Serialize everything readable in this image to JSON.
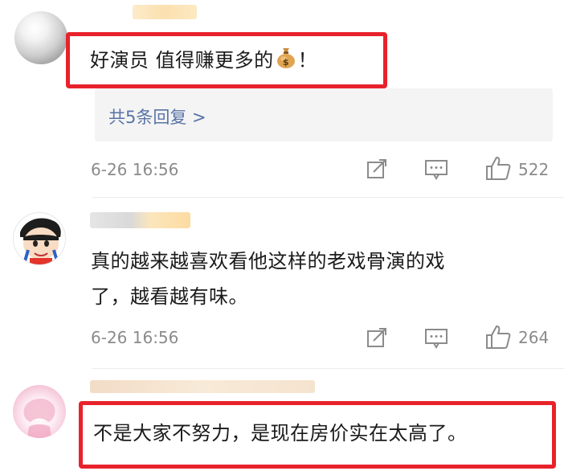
{
  "comments": [
    {
      "text": "好演员 值得赚更多的",
      "emoji_alt": "money-bag",
      "text_suffix": "！",
      "replies_label": "共5条回复 >",
      "time": "6-26 16:56",
      "likes": "522"
    },
    {
      "text_line1": "真的越来越喜欢看他这样的老戏骨演的戏",
      "text_line2": "了，越看越有味。",
      "time": "6-26 16:56",
      "likes": "264"
    },
    {
      "text": "不是大家不努力，是现在房价实在太高了。"
    }
  ],
  "colors": {
    "highlight": "#e8222b",
    "link": "#5873a7",
    "meta": "#8b8b8b"
  },
  "icons": [
    "repost-icon",
    "comment-icon",
    "like-icon"
  ]
}
